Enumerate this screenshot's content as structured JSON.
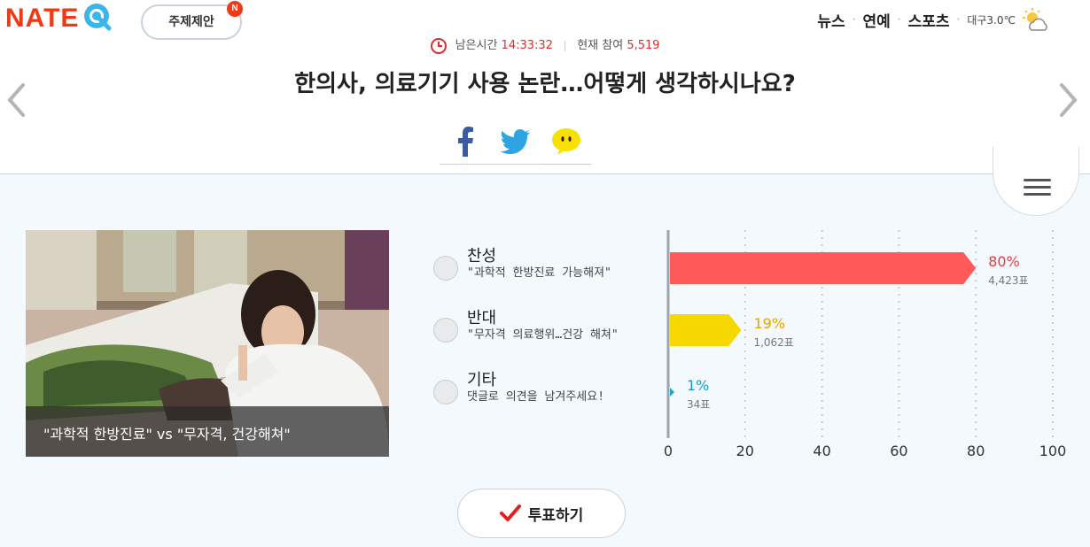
{
  "header": {
    "logo_text": "NATE",
    "suggest_label": "주제제안",
    "suggest_badge": "N",
    "nav": [
      "뉴스",
      "연예",
      "스포츠"
    ],
    "weather_text": "대구3.0℃",
    "weather_icon": "partly-cloudy-icon"
  },
  "poll": {
    "remaining_label": "남은시간",
    "remaining_time": "14:33:32",
    "participants_label": "현재 참여",
    "participants": "5,519",
    "title": "한의사, 의료기기 사용 논란…어떻게 생각하시나요?",
    "photo_caption": "\"과학적 한방진료\" vs \"무자격, 건강해쳐\"",
    "vote_label": "투표하기"
  },
  "share": [
    "facebook-icon",
    "twitter-icon",
    "kakaotalk-icon"
  ],
  "options": [
    {
      "title": "찬성",
      "subtitle": "\"과학적 한방진료 가능해져\""
    },
    {
      "title": "반대",
      "subtitle": "\"무자격 의료행위…건강 해쳐\""
    },
    {
      "title": "기타",
      "subtitle": "댓글로 의견을 남겨주세요!"
    }
  ],
  "chart_data": {
    "type": "bar",
    "orientation": "horizontal",
    "categories": [
      "찬성",
      "반대",
      "기타"
    ],
    "values": [
      80,
      19,
      1
    ],
    "value_labels": [
      "80%",
      "19%",
      "1%"
    ],
    "vote_labels": [
      "4,423표",
      "1,062표",
      "34표"
    ],
    "colors": [
      "#ff5a5a",
      "#f6d800",
      "#22a5c9"
    ],
    "label_colors": [
      "#e83c3c",
      "#e0a500",
      "#1c9cc2"
    ],
    "xlim": [
      0,
      100
    ],
    "xticks": [
      "0",
      "20",
      "40",
      "60",
      "80",
      "100"
    ],
    "grid": true
  }
}
